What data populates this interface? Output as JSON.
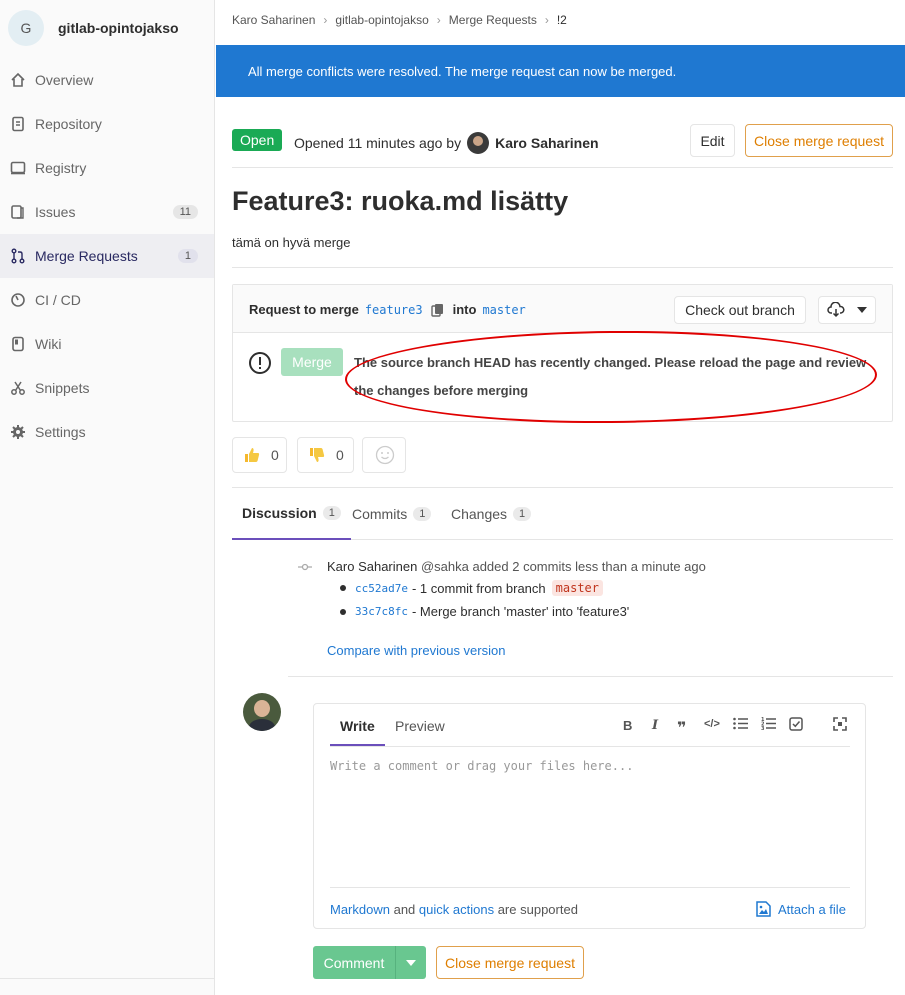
{
  "project": {
    "initial": "G",
    "name": "gitlab-opintojakso"
  },
  "nav": [
    {
      "label": "Overview",
      "icon": "home-icon"
    },
    {
      "label": "Repository",
      "icon": "doc-icon"
    },
    {
      "label": "Registry",
      "icon": "container-icon"
    },
    {
      "label": "Issues",
      "icon": "issues-icon",
      "count": "11"
    },
    {
      "label": "Merge Requests",
      "icon": "merge-request-icon",
      "count": "1"
    },
    {
      "label": "CI / CD",
      "icon": "rocket-icon"
    },
    {
      "label": "Wiki",
      "icon": "book-icon"
    },
    {
      "label": "Snippets",
      "icon": "scissors-icon"
    },
    {
      "label": "Settings",
      "icon": "gear-icon"
    }
  ],
  "breadcrumb": [
    "Karo Saharinen",
    "gitlab-opintojakso",
    "Merge Requests",
    "!2"
  ],
  "flash": "All merge conflicts were resolved. The merge request can now be merged.",
  "header": {
    "status": "Open",
    "opened": "Opened 11 minutes ago by",
    "author": "Karo Saharinen",
    "edit": "Edit",
    "close": "Close merge request"
  },
  "mr": {
    "title": "Feature3: ruoka.md lisätty",
    "description": "tämä on hyvä merge"
  },
  "widget": {
    "request_to_merge": "Request to merge",
    "source_branch": "feature3",
    "into": "into",
    "target_branch": "master",
    "checkout": "Check out branch",
    "merge": "Merge",
    "message": "The source branch HEAD has recently changed. Please reload the page and review the changes before merging"
  },
  "awards": {
    "thumbsup": "0",
    "thumbsdown": "0"
  },
  "tabs": [
    {
      "label": "Discussion",
      "count": "1"
    },
    {
      "label": "Commits",
      "count": "1"
    },
    {
      "label": "Changes",
      "count": "1"
    }
  ],
  "note": {
    "author": "Karo Saharinen",
    "text": "@sahka added 2 commits less than a minute ago",
    "commits": [
      {
        "sha": "cc52ad7e",
        "text": "- 1 commit from branch",
        "branch": "master"
      },
      {
        "sha": "33c7c8fc",
        "text": "- Merge branch 'master' into 'feature3'"
      }
    ],
    "compare": "Compare with previous version"
  },
  "editor": {
    "write": "Write",
    "preview": "Preview",
    "placeholder": "Write a comment or drag your files here...",
    "markdown": "Markdown",
    "and": "and",
    "quick_actions": "quick actions",
    "supported": "are supported",
    "attach": "Attach a file"
  },
  "actions": {
    "comment": "Comment",
    "close": "Close merge request"
  },
  "colors": {
    "primary": "#1f78d1",
    "success": "#1aaa55",
    "warning": "#de7e00",
    "annotation": "#e00000"
  }
}
